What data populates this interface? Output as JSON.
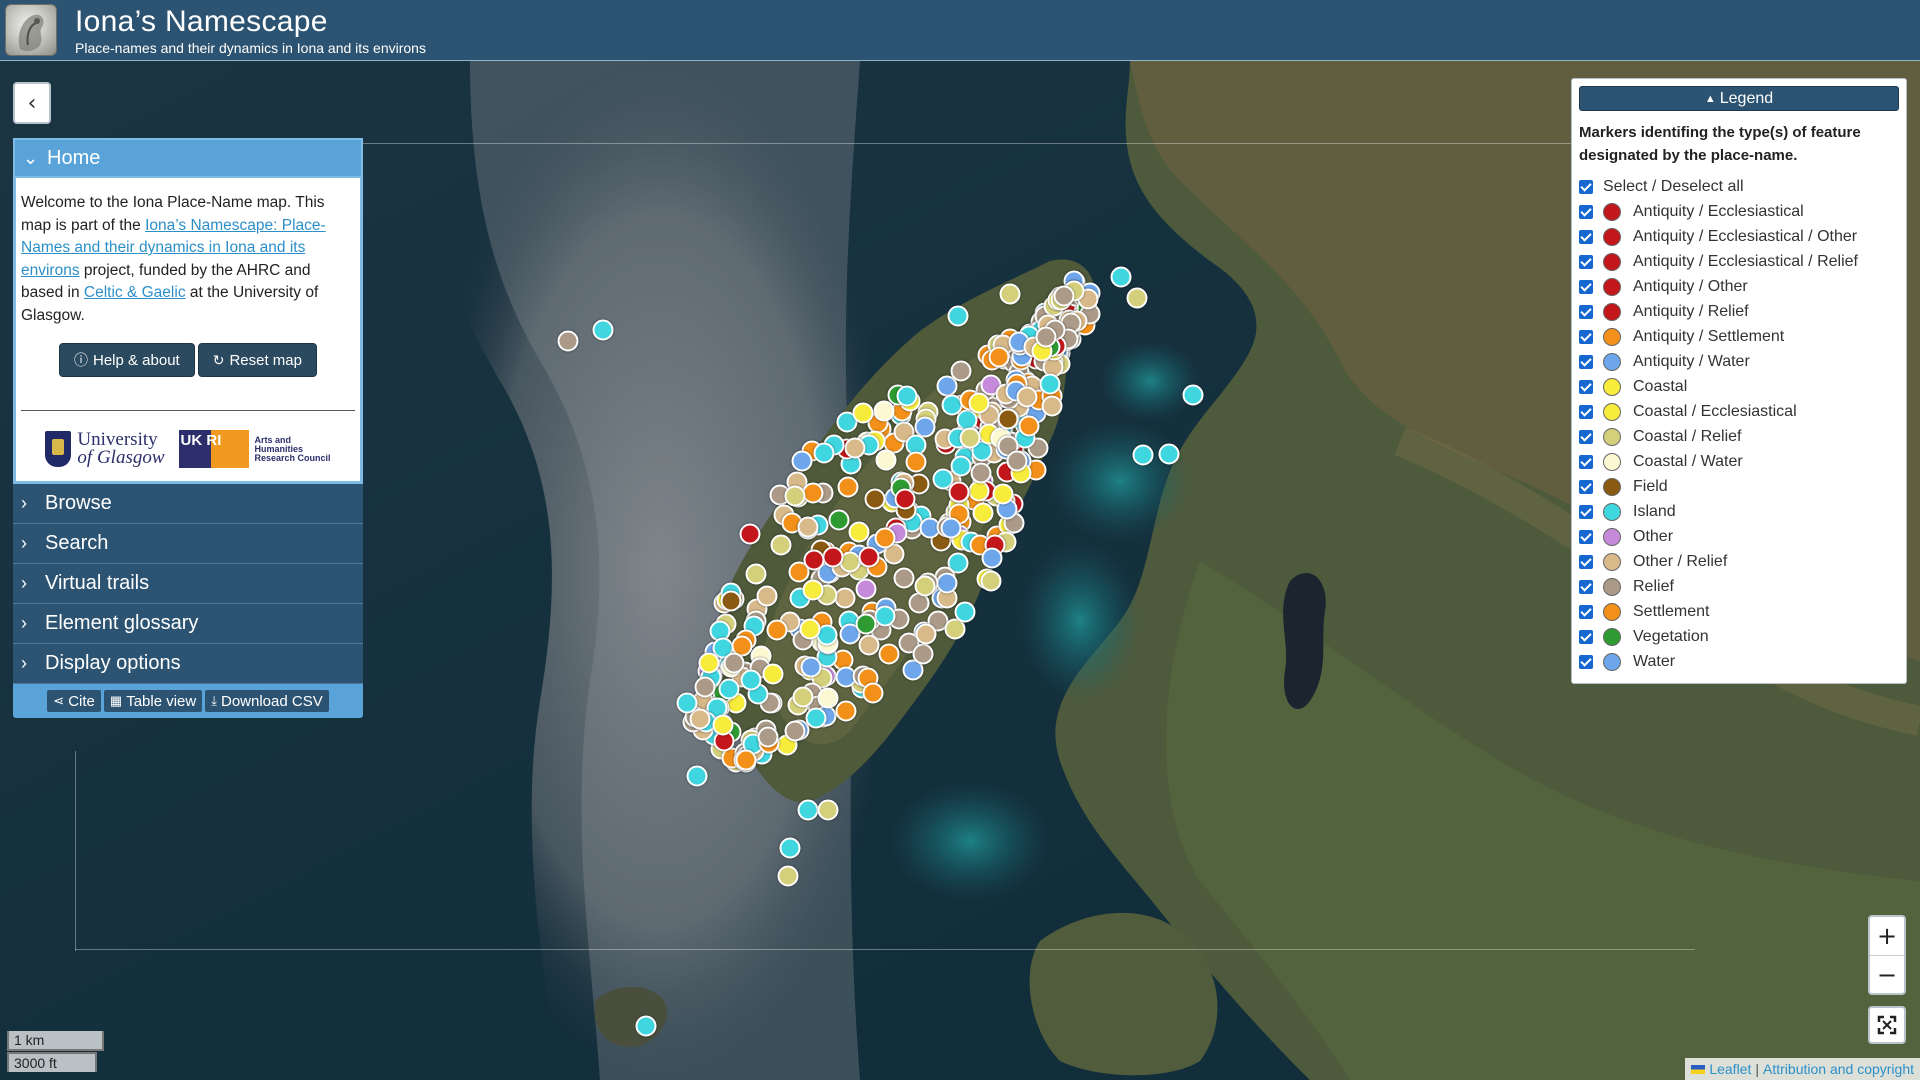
{
  "header": {
    "title": "Iona’s Namescape",
    "subtitle": "Place-names and their dynamics in Iona and its environs",
    "logo_icon": "iona-namescape-logo"
  },
  "sidebar": {
    "collapse_icon": "chevron-left-icon",
    "home": {
      "label": "Home",
      "intro_1": "Welcome to the Iona Place-Name map. This map is part of the ",
      "project_link": "Iona’s Namescape: Place-Names and their dynamics in Iona and its environs",
      "intro_2": " project, funded by the AHRC and based in ",
      "dept_link": "Celtic & Gaelic",
      "intro_3": " at the University of Glasgow.",
      "help_button": "Help & about",
      "reset_button": "Reset map",
      "uog_line1": "University",
      "uog_line2": "of Glasgow",
      "ukri_mark": "UK RI",
      "ahrc_line1": "Arts and",
      "ahrc_line2": "Humanities",
      "ahrc_line3": "Research Council"
    },
    "sections": [
      {
        "label": "Browse"
      },
      {
        "label": "Search"
      },
      {
        "label": "Virtual trails"
      },
      {
        "label": "Element glossary"
      },
      {
        "label": "Display options"
      }
    ],
    "footer_buttons": {
      "cite": "Cite",
      "table": "Table view",
      "download": "Download CSV"
    }
  },
  "legend": {
    "toggle_label": "Legend",
    "intro": "Markers identifing the type(s) of feature designated by the place-name.",
    "select_all": "Select / Deselect all",
    "items": [
      {
        "label": "Antiquity / Ecclesiastical",
        "color": "#c4171b"
      },
      {
        "label": "Antiquity / Ecclesiastical / Other",
        "color": "#c4171b"
      },
      {
        "label": "Antiquity / Ecclesiastical / Relief",
        "color": "#c4171b"
      },
      {
        "label": "Antiquity / Other",
        "color": "#c4171b"
      },
      {
        "label": "Antiquity / Relief",
        "color": "#c4171b"
      },
      {
        "label": "Antiquity / Settlement",
        "color": "#f39019"
      },
      {
        "label": "Antiquity / Water",
        "color": "#6da6ea"
      },
      {
        "label": "Coastal",
        "color": "#f7ec3c"
      },
      {
        "label": "Coastal / Ecclesiastical",
        "color": "#f7ec3c"
      },
      {
        "label": "Coastal / Relief",
        "color": "#d4cf7a"
      },
      {
        "label": "Coastal / Water",
        "color": "#fbf8d2"
      },
      {
        "label": "Field",
        "color": "#8a5a12"
      },
      {
        "label": "Island",
        "color": "#3fd6e0"
      },
      {
        "label": "Other",
        "color": "#c58ad9"
      },
      {
        "label": "Other / Relief",
        "color": "#d8b98a"
      },
      {
        "label": "Relief",
        "color": "#aa9a87"
      },
      {
        "label": "Settlement",
        "color": "#f39019"
      },
      {
        "label": "Vegetation",
        "color": "#2e9a32"
      },
      {
        "label": "Water",
        "color": "#6da6ea"
      }
    ]
  },
  "controls": {
    "zoom_in": "+",
    "zoom_out": "−",
    "fullscreen_icon": "fullscreen-icon"
  },
  "scale": {
    "metric": "1 km",
    "imperial": "3000 ft"
  },
  "attribution": {
    "leaflet": "Leaflet",
    "credit": "Attribution and copyright"
  }
}
